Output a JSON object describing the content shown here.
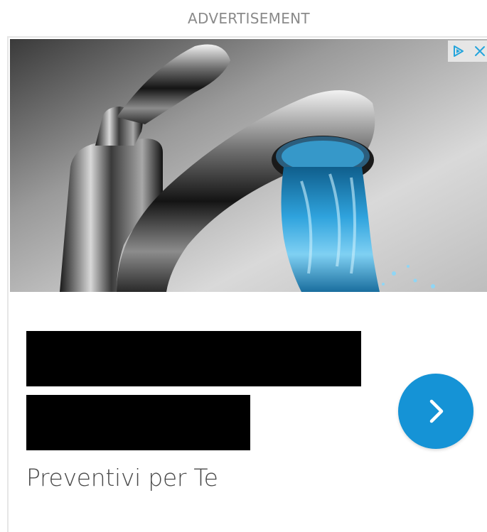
{
  "ad": {
    "header_label": "ADVERTISEMENT",
    "image_alt": "Chrome faucet with running blue water",
    "sponsor": "Preventivi per Te",
    "headline_line1": "",
    "headline_line2": "",
    "adchoices_icon": "adchoices-icon",
    "close_icon": "close-icon",
    "cta_icon": "chevron-right-icon"
  },
  "colors": {
    "cta_background": "#1593d6",
    "adchoices_icon": "#25a5dc",
    "header_text": "#8a8a8a",
    "sponsor_text": "#4a4a4a",
    "water": "#2d9bd6"
  }
}
